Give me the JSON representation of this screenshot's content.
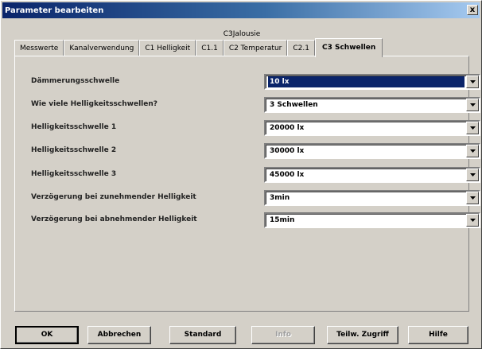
{
  "window": {
    "title": "Parameter bearbeiten",
    "close_glyph": "x"
  },
  "group_label": "C3Jalousie",
  "tabs": [
    {
      "label": "Messwerte",
      "active": false
    },
    {
      "label": "Kanalverwendung",
      "active": false
    },
    {
      "label": "C1 Helligkeit",
      "active": false
    },
    {
      "label": "C1.1",
      "active": false
    },
    {
      "label": "C2 Temperatur",
      "active": false
    },
    {
      "label": "C2.1",
      "active": false
    },
    {
      "label": "C3 Schwellen",
      "active": true
    }
  ],
  "rows": [
    {
      "label": "Dämmerungsschwelle",
      "value": "10 lx"
    },
    {
      "label": "Wie viele Helligkeitsschwellen?",
      "value": "3 Schwellen"
    },
    {
      "label": "Helligkeitsschwelle 1",
      "value": "20000 lx"
    },
    {
      "label": "Helligkeitsschwelle 2",
      "value": "30000 lx"
    },
    {
      "label": "Helligkeitsschwelle 3",
      "value": "45000 lx"
    },
    {
      "label": "Verzögerung bei zunehmender Helligkeit",
      "value": "3min"
    },
    {
      "label": "Verzögerung bei abnehmender Helligkeit",
      "value": "15min"
    }
  ],
  "buttons": {
    "ok": "OK",
    "cancel": "Abbrechen",
    "standard": "Standard",
    "info": "Info",
    "partial_access": "Teilw. Zugriff",
    "help": "Hilfe"
  }
}
